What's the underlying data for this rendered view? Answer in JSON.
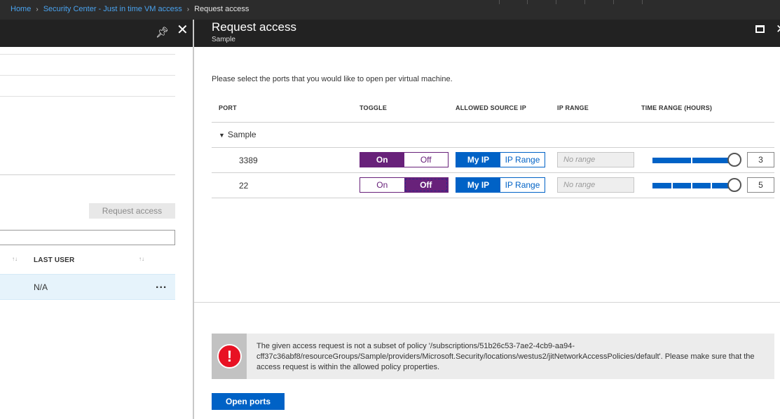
{
  "breadcrumb": {
    "items": [
      "Home",
      "Security Center - Just in time VM access"
    ],
    "current": "Request access"
  },
  "left_blade": {
    "request_access_label": "Request access",
    "col_last_user": "LAST USER",
    "row_last_user": "N/A",
    "row_more": "..."
  },
  "blade": {
    "title": "Request access",
    "subtitle": "Sample"
  },
  "instruction": "Please select the ports that you would like to open per virtual machine.",
  "columns": {
    "port": "PORT",
    "toggle": "TOGGLE",
    "allowed_source_ip": "ALLOWED SOURCE IP",
    "ip_range": "IP RANGE",
    "time_range": "TIME RANGE (HOURS)"
  },
  "vm_group": "Sample",
  "ports": [
    {
      "port": "3389",
      "toggle_on": "On",
      "toggle_off": "Off",
      "toggle_selected": "On",
      "my_ip": "My IP",
      "ip_range_btn": "IP Range",
      "source_selected": "My IP",
      "ip_range_placeholder": "No range",
      "hours": "3",
      "slider_fraction": 1.0
    },
    {
      "port": "22",
      "toggle_on": "On",
      "toggle_off": "Off",
      "toggle_selected": "Off",
      "my_ip": "My IP",
      "ip_range_btn": "IP Range",
      "source_selected": "My IP",
      "ip_range_placeholder": "No range",
      "hours": "5",
      "slider_fraction": 1.0
    }
  ],
  "error": {
    "message": "The given access request is not a subset of policy '/subscriptions/51b26c53-7ae2-4cb9-aa94-cff37c36abf8/resourceGroups/Sample/providers/Microsoft.Security/locations/westus2/jitNetworkAccessPolicies/default'. Please make sure that the access request is within the allowed policy properties.",
    "icon": "!"
  },
  "open_ports_label": "Open ports",
  "colors": {
    "accent_blue": "#0062c6",
    "toggle_purple": "#68217a",
    "error_red": "#e81123",
    "header_dark": "#222222"
  }
}
